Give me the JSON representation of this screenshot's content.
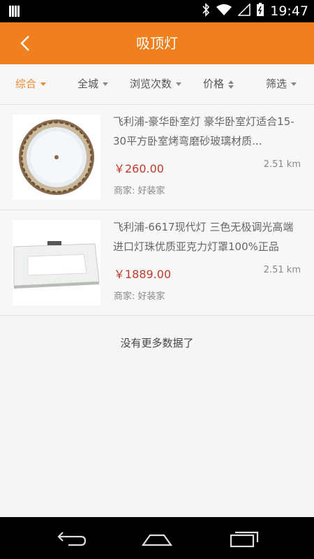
{
  "status_bar": {
    "time": "19:47"
  },
  "app_bar": {
    "title": "吸顶灯"
  },
  "filters": [
    {
      "label": "综合",
      "active": true
    },
    {
      "label": "全城",
      "active": false
    },
    {
      "label": "浏览次数",
      "active": false
    },
    {
      "label": "价格",
      "active": false
    },
    {
      "label": "筛选",
      "active": false
    }
  ],
  "products": [
    {
      "title": "飞利浦-豪华卧室灯 豪华卧室灯适合15-30平方卧室烤弯磨砂玻璃材质...",
      "price": "￥260.00",
      "distance": "2.51 km",
      "merchant": "商家: 好装家",
      "image_icon": "round-ceiling-lamp"
    },
    {
      "title": "飞利浦-6617现代灯 三色无极调光高端进口灯珠优质亚克力灯罩100%正品",
      "price": "￥1889.00",
      "distance": "2.51 km",
      "merchant": "商家: 好装家",
      "image_icon": "square-ceiling-lamp"
    }
  ],
  "footer": {
    "no_more": "没有更多数据了"
  },
  "colors": {
    "accent": "#f07f1e",
    "active_filter": "#e98a30",
    "price": "#c0392b"
  }
}
